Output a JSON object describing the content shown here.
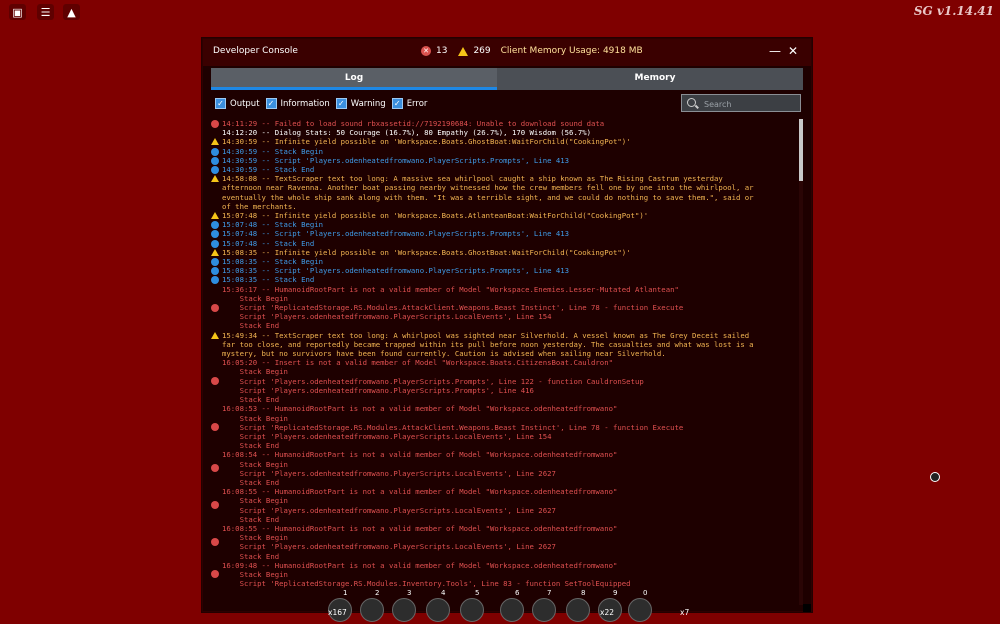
{
  "top_icons": [
    "roblox-menu-icon",
    "chat-icon",
    "backpack-icon"
  ],
  "version": "SG v1.14.41",
  "console": {
    "title": "Developer Console",
    "error_count": "13",
    "warning_count": "269",
    "memory_label": "Client Memory Usage: 4918 MB",
    "tabs": [
      "Log",
      "Memory"
    ],
    "active_tab": "Log",
    "filters": [
      "Output",
      "Information",
      "Warning",
      "Error"
    ],
    "search_placeholder": "Search",
    "colors": {
      "output": "#ffffff",
      "info": "#3f9be8",
      "warning": "#f3b552",
      "error": "#e05050",
      "background": "#7f0000"
    }
  },
  "log": [
    {
      "type": "error",
      "lines": [
        "14:11:29 -- Failed to load sound rbxassetid://7192190684: Unable to download sound data"
      ]
    },
    {
      "type": "output",
      "lines": [
        "14:12:20 -- Dialog Stats: 50 Courage (16.7%), 80 Empathy (26.7%), 170 Wisdom (56.7%)"
      ]
    },
    {
      "type": "warning",
      "lines": [
        "14:30:59 -- Infinite yield possible on 'Workspace.Boats.GhostBoat:WaitForChild(\"CookingPot\")'"
      ]
    },
    {
      "type": "info",
      "lines": [
        "14:30:59 -- Stack Begin"
      ]
    },
    {
      "type": "info",
      "lines": [
        "14:30:59 -- Script 'Players.odenheatedfromwano.PlayerScripts.Prompts', Line 413"
      ]
    },
    {
      "type": "info",
      "lines": [
        "14:30:59 -- Stack End"
      ]
    },
    {
      "type": "warning",
      "lines": [
        "14:58:08 -- TextScraper text too long: A massive sea whirlpool caught a ship known as The Rising Castrum yesterday",
        "afternoon near Ravenna. Another boat passing nearby witnessed how the crew members fell one by one into the whirlpool, ar",
        "eventually the whole ship sank along with them. \"It was a terrible sight, and we could do nothing to save them.\", said or",
        "of the merchants."
      ]
    },
    {
      "type": "warning",
      "lines": [
        "15:07:48 -- Infinite yield possible on 'Workspace.Boats.AtlanteanBoat:WaitForChild(\"CookingPot\")'"
      ]
    },
    {
      "type": "info",
      "lines": [
        "15:07:48 -- Stack Begin"
      ]
    },
    {
      "type": "info",
      "lines": [
        "15:07:48 -- Script 'Players.odenheatedfromwano.PlayerScripts.Prompts', Line 413"
      ]
    },
    {
      "type": "info",
      "lines": [
        "15:07:48 -- Stack End"
      ]
    },
    {
      "type": "warning",
      "lines": [
        "15:08:35 -- Infinite yield possible on 'Workspace.Boats.GhostBoat:WaitForChild(\"CookingPot\")'"
      ]
    },
    {
      "type": "info",
      "lines": [
        "15:08:35 -- Stack Begin"
      ]
    },
    {
      "type": "info",
      "lines": [
        "15:08:35 -- Script 'Players.odenheatedfromwano.PlayerScripts.Prompts', Line 413"
      ]
    },
    {
      "type": "info",
      "lines": [
        "15:08:35 -- Stack End"
      ]
    },
    {
      "type": "error",
      "lines": [
        "15:36:17 -- HumanoidRootPart is not a valid member of Model \"Workspace.Enemies.Lesser-Mutated Atlantean\"",
        "    Stack Begin",
        "    Script 'ReplicatedStorage.RS.Modules.AttackClient.Weapons.Beast Instinct', Line 78 - function Execute",
        "    Script 'Players.odenheatedfromwano.PlayerScripts.LocalEvents', Line 154",
        "    Stack End"
      ]
    },
    {
      "type": "warning",
      "lines": [
        "15:49:34 -- TextScraper text too long: A whirlpool was sighted near Silverhold. A vessel known as The Grey Deceit sailed",
        "far too close, and reportedly became trapped within its pull before noon yesterday. The casualties and what was lost is a",
        "mystery, but no survivors have been found currently. Caution is advised when sailing near Silverhold."
      ]
    },
    {
      "type": "error",
      "lines": [
        "16:05:20 -- Insert is not a valid member of Model \"Workspace.Boats.CitizensBoat.Cauldron\"",
        "    Stack Begin",
        "    Script 'Players.odenheatedfromwano.PlayerScripts.Prompts', Line 122 - function CauldronSetup",
        "    Script 'Players.odenheatedfromwano.PlayerScripts.Prompts', Line 416",
        "    Stack End"
      ]
    },
    {
      "type": "error",
      "lines": [
        "16:08:53 -- HumanoidRootPart is not a valid member of Model \"Workspace.odenheatedfromwano\"",
        "    Stack Begin",
        "    Script 'ReplicatedStorage.RS.Modules.AttackClient.Weapons.Beast Instinct', Line 78 - function Execute",
        "    Script 'Players.odenheatedfromwano.PlayerScripts.LocalEvents', Line 154",
        "    Stack End"
      ]
    },
    {
      "type": "error",
      "lines": [
        "16:08:54 -- HumanoidRootPart is not a valid member of Model \"Workspace.odenheatedfromwano\"",
        "    Stack Begin",
        "    Script 'Players.odenheatedfromwano.PlayerScripts.LocalEvents', Line 2627",
        "    Stack End"
      ]
    },
    {
      "type": "error",
      "lines": [
        "16:08:55 -- HumanoidRootPart is not a valid member of Model \"Workspace.odenheatedfromwano\"",
        "    Stack Begin",
        "    Script 'Players.odenheatedfromwano.PlayerScripts.LocalEvents', Line 2627",
        "    Stack End"
      ]
    },
    {
      "type": "error",
      "lines": [
        "16:08:55 -- HumanoidRootPart is not a valid member of Model \"Workspace.odenheatedfromwano\"",
        "    Stack Begin",
        "    Script 'Players.odenheatedfromwano.PlayerScripts.LocalEvents', Line 2627",
        "    Stack End"
      ]
    },
    {
      "type": "error",
      "lines": [
        "16:09:48 -- HumanoidRootPart is not a valid member of Model \"Workspace.odenheatedfromwano\"",
        "    Stack Begin",
        "    Script 'ReplicatedStorage.RS.Modules.Inventory.Tools', Line 83 - function SetToolEquipped"
      ]
    }
  ],
  "hotbar": {
    "slots": [
      "1",
      "2",
      "3",
      "4",
      "5",
      "6",
      "7",
      "8",
      "9",
      "0"
    ],
    "counts": [
      "x167",
      "x22",
      "x7"
    ]
  }
}
